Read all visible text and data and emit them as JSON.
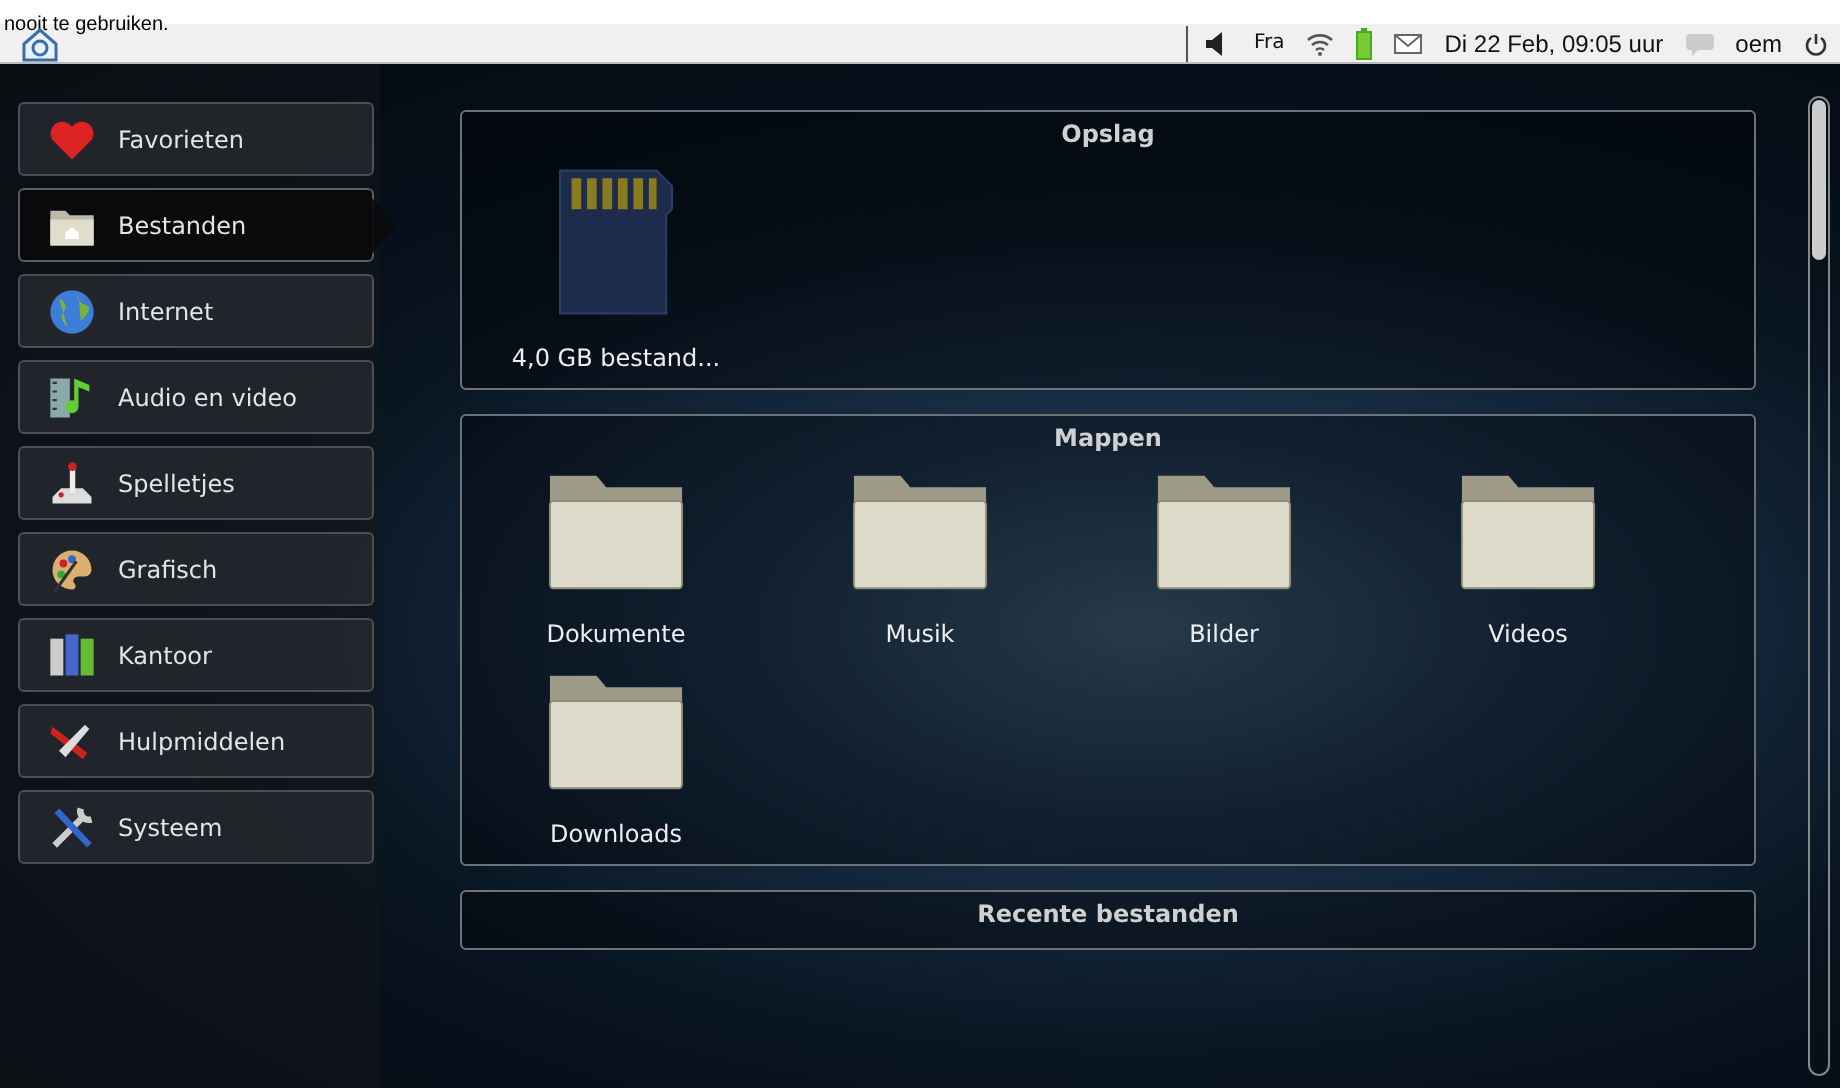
{
  "caption": "nooit te gebruiken.",
  "panel": {
    "language": "Fra",
    "clock": "Di 22 Feb, 09:05 uur",
    "user": "oem"
  },
  "sidebar": {
    "items": [
      {
        "label": "Favorieten",
        "selected": false
      },
      {
        "label": "Bestanden",
        "selected": true
      },
      {
        "label": "Internet",
        "selected": false
      },
      {
        "label": "Audio en video",
        "selected": false
      },
      {
        "label": "Spelletjes",
        "selected": false
      },
      {
        "label": "Grafisch",
        "selected": false
      },
      {
        "label": "Kantoor",
        "selected": false
      },
      {
        "label": "Hulpmiddelen",
        "selected": false
      },
      {
        "label": "Systeem",
        "selected": false
      }
    ]
  },
  "sections": [
    {
      "title": "Opslag",
      "items": [
        {
          "label": "4,0 GB bestand...",
          "kind": "sdcard"
        }
      ]
    },
    {
      "title": "Mappen",
      "items": [
        {
          "label": "Dokumente",
          "kind": "folder"
        },
        {
          "label": "Musik",
          "kind": "folder"
        },
        {
          "label": "Bilder",
          "kind": "folder"
        },
        {
          "label": "Videos",
          "kind": "folder"
        },
        {
          "label": "Downloads",
          "kind": "folder"
        }
      ]
    },
    {
      "title": "Recente bestanden"
    }
  ]
}
